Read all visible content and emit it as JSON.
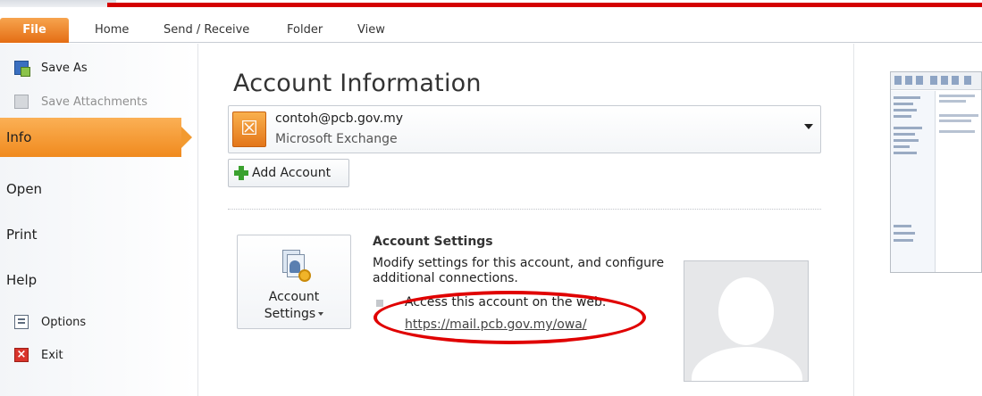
{
  "ribbon": {
    "tabs": [
      {
        "label": "File"
      },
      {
        "label": "Home"
      },
      {
        "label": "Send / Receive"
      },
      {
        "label": "Folder"
      },
      {
        "label": "View"
      }
    ]
  },
  "nav": {
    "commands": {
      "save_as": "Save As",
      "save_attachments": "Save Attachments",
      "options": "Options",
      "exit": "Exit"
    },
    "items": {
      "info": "Info",
      "open": "Open",
      "print": "Print",
      "help": "Help"
    },
    "selected": "Info",
    "accent_color": "#f29a30"
  },
  "main": {
    "title": "Account Information",
    "account": {
      "email": "contoh@pcb.gov.my",
      "type": "Microsoft Exchange"
    },
    "add_account_label": "Add Account",
    "account_settings": {
      "button_line1": "Account",
      "button_line2": "Settings",
      "heading": "Account Settings",
      "description": "Modify settings for this account, and configure additional connections.",
      "web_access_label": "Access this account on the web.",
      "web_access_url": "https://mail.pcb.gov.my/owa/"
    }
  },
  "annotation": {
    "color": "#e00000"
  },
  "icons": [
    "save-as-icon",
    "save-attachments-icon",
    "options-icon",
    "exit-icon",
    "exchange-icon",
    "add-account-icon",
    "account-settings-icon",
    "dropdown-arrow-icon"
  ]
}
